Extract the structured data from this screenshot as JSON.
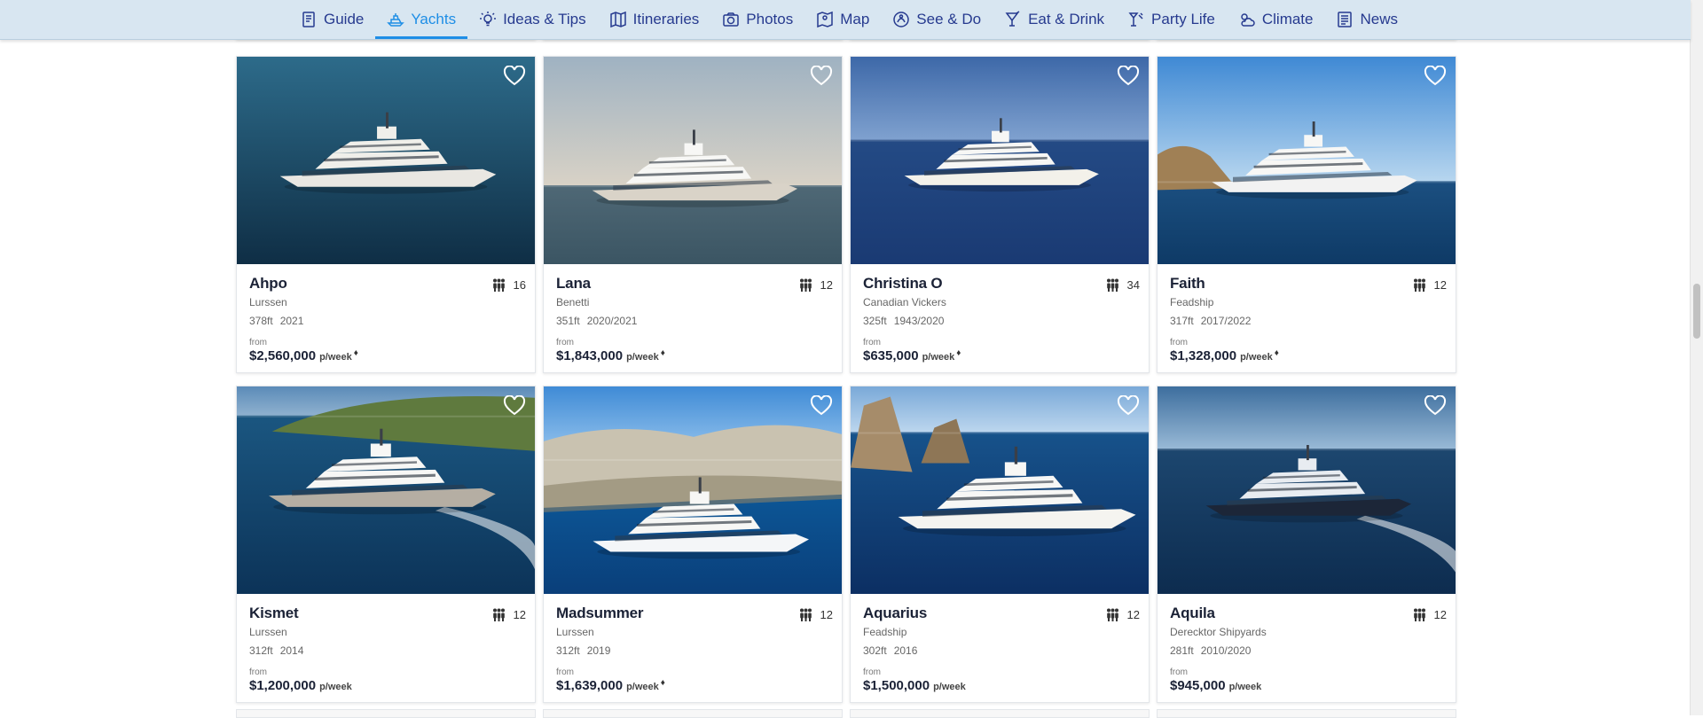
{
  "nav": [
    {
      "label": "Guide",
      "icon": "guide-icon",
      "active": false
    },
    {
      "label": "Yachts",
      "icon": "yacht-icon",
      "active": true
    },
    {
      "label": "Ideas & Tips",
      "icon": "bulb-icon",
      "active": false
    },
    {
      "label": "Itineraries",
      "icon": "itinerary-map-icon",
      "active": false
    },
    {
      "label": "Photos",
      "icon": "camera-icon",
      "active": false
    },
    {
      "label": "Map",
      "icon": "map-icon",
      "active": false
    },
    {
      "label": "See & Do",
      "icon": "see-do-icon",
      "active": false
    },
    {
      "label": "Eat & Drink",
      "icon": "cocktail-icon",
      "active": false
    },
    {
      "label": "Party Life",
      "icon": "party-icon",
      "active": false
    },
    {
      "label": "Climate",
      "icon": "climate-icon",
      "active": false
    },
    {
      "label": "News",
      "icon": "news-icon",
      "active": false
    }
  ],
  "yachts": [
    {
      "name": "Ahpo",
      "builder": "Lurssen",
      "length": "378ft",
      "year": "2021",
      "guests": "16",
      "from": "from",
      "price": "$2,560,000",
      "per": "p/week",
      "diamond": true
    },
    {
      "name": "Lana",
      "builder": "Benetti",
      "length": "351ft",
      "year": "2020/2021",
      "guests": "12",
      "from": "from",
      "price": "$1,843,000",
      "per": "p/week",
      "diamond": true
    },
    {
      "name": "Christina O",
      "builder": "Canadian Vickers",
      "length": "325ft",
      "year": "1943/2020",
      "guests": "34",
      "from": "from",
      "price": "$635,000",
      "per": "p/week",
      "diamond": true
    },
    {
      "name": "Faith",
      "builder": "Feadship",
      "length": "317ft",
      "year": "2017/2022",
      "guests": "12",
      "from": "from",
      "price": "$1,328,000",
      "per": "p/week",
      "diamond": true
    },
    {
      "name": "Kismet",
      "builder": "Lurssen",
      "length": "312ft",
      "year": "2014",
      "guests": "12",
      "from": "from",
      "price": "$1,200,000",
      "per": "p/week",
      "diamond": false
    },
    {
      "name": "Madsummer",
      "builder": "Lurssen",
      "length": "312ft",
      "year": "2019",
      "guests": "12",
      "from": "from",
      "price": "$1,639,000",
      "per": "p/week",
      "diamond": true
    },
    {
      "name": "Aquarius",
      "builder": "Feadship",
      "length": "302ft",
      "year": "2016",
      "guests": "12",
      "from": "from",
      "price": "$1,500,000",
      "per": "p/week",
      "diamond": false
    },
    {
      "name": "Aquila",
      "builder": "Derecktor Shipyards",
      "length": "281ft",
      "year": "2010/2020",
      "guests": "12",
      "from": "from",
      "price": "$945,000",
      "per": "p/week",
      "diamond": false
    }
  ],
  "colors": {
    "accent": "#1e8ee6",
    "nav_text": "#263a8f",
    "nav_bg": "#d8e6f1"
  }
}
